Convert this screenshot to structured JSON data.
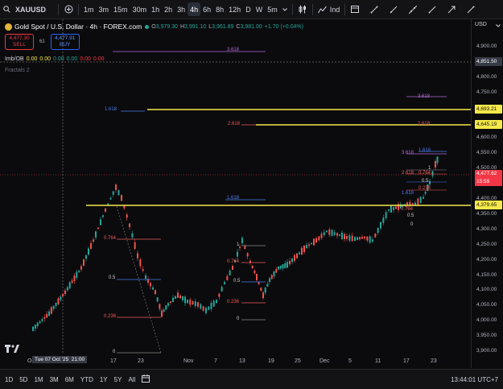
{
  "toolbar": {
    "symbol": "XAUUSD",
    "timeframes": [
      "1m",
      "3m",
      "15m",
      "30m",
      "1h",
      "2h",
      "3h",
      "4h",
      "6h",
      "8h",
      "12h",
      "D",
      "W",
      "5m"
    ],
    "active_timeframe": "4h",
    "indicators_label": "Ind"
  },
  "legend": {
    "title": "Gold Spot / U.S. Dollar · 4h · FOREX.com",
    "o_label": "O",
    "o": "3,979.30",
    "h_label": "H",
    "h": "3,991.10",
    "l_label": "L",
    "l": "3,961.89",
    "c_label": "C",
    "c": "3,981.00",
    "change": "+1.70 (+0.04%)",
    "sell_price": "4,477.30",
    "sell_label": "SELL",
    "spread": "61",
    "buy_price": "4,477.91",
    "buy_label": "BUY",
    "indicator1_name": "Imb/OB",
    "indicator1_values": [
      "0.00",
      "0.00",
      "0.00",
      "0.00",
      "0.00",
      "0.00"
    ],
    "indicator2_name": "Fractals 2"
  },
  "currency": "USD",
  "price_axis": {
    "labels": [
      "4,900.00",
      "4,850.00",
      "4,800.00",
      "4,750.00",
      "4,700.00",
      "4,650.00",
      "4,600.00",
      "4,550.00",
      "4,500.00",
      "4,450.00",
      "4,400.00",
      "4,350.00",
      "4,300.00",
      "4,250.00",
      "4,200.00",
      "4,150.00",
      "4,100.00",
      "4,050.00",
      "4,000.00",
      "3,950.00",
      "3,900.00"
    ],
    "crosshair_price": "4,851.50",
    "tag_4693": "4,693.21",
    "tag_4645": "4,645.19",
    "tag_current": "4,477.62",
    "countdown": "15:59",
    "tag_4379": "4,379.65"
  },
  "fib_labels": {
    "f3618a": "3.618",
    "f1618a": "1.618",
    "f2618a": "2.618",
    "f3618b": "3.618",
    "f2618b": "2.618",
    "f3618c": "3.618",
    "f1618b": "1.618",
    "f1618c": "1.618",
    "f1": "1",
    "f0764": "0.764",
    "f2618c": "2.618",
    "f05": "0.5",
    "f0236": "0.236",
    "f1618d": "1.618",
    "f0764b": "0.764",
    "f05b": "0.5",
    "f0b": "0",
    "left_0764": "0.764",
    "left_05": "0.5",
    "left_0236": "0.236",
    "left_0": "0",
    "mid_1": "1",
    "mid_0764": "0.764",
    "mid_05": "0.5",
    "mid_0236": "0.236",
    "mid_0": "0",
    "m_0236b": "0.236",
    "m_1b": "1"
  },
  "time_axis": {
    "crosshair_time": "Tue 07 Oct '25  21:00",
    "labels": [
      "Oc",
      "17",
      "23",
      "Nov",
      "7",
      "13",
      "19",
      "25",
      "Dec",
      "5",
      "11",
      "17",
      "23"
    ]
  },
  "bottombar": {
    "ranges": [
      "1D",
      "5D",
      "1M",
      "3M",
      "6M",
      "YTD",
      "1Y",
      "5Y",
      "All"
    ],
    "clock": "13:44:01 UTC+7"
  },
  "colors": {
    "up": "#26a69a",
    "down": "#ef5350",
    "yellow": "#f5e84a",
    "sell": "#f23645",
    "buy": "#2962ff",
    "fib_blue": "#4c7cf0",
    "fib_red": "#f05a5a",
    "fib_purple": "#b06ad6"
  }
}
